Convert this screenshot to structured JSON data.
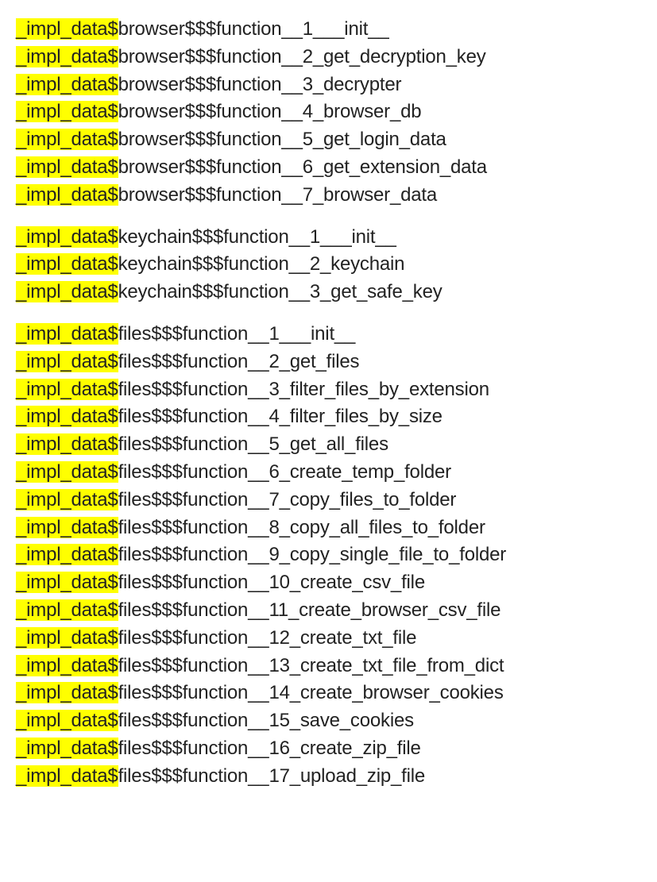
{
  "highlight_prefix": "_impl_data$",
  "groups": [
    {
      "module": "browser",
      "functions": [
        "1___init__",
        "2_get_decryption_key",
        "3_decrypter",
        "4_browser_db",
        "5_get_login_data",
        "6_get_extension_data",
        "7_browser_data"
      ]
    },
    {
      "module": "keychain",
      "functions": [
        "1___init__",
        "2_keychain",
        "3_get_safe_key"
      ]
    },
    {
      "module": "files",
      "functions": [
        "1___init__",
        "2_get_files",
        "3_filter_files_by_extension",
        "4_filter_files_by_size",
        "5_get_all_files",
        "6_create_temp_folder",
        "7_copy_files_to_folder",
        "8_copy_all_files_to_folder",
        "9_copy_single_file_to_folder",
        "10_create_csv_file",
        "11_create_browser_csv_file",
        "12_create_txt_file",
        "13_create_txt_file_from_dict",
        "14_create_browser_cookies",
        "15_save_cookies",
        "16_create_zip_file",
        "17_upload_zip_file"
      ]
    }
  ]
}
